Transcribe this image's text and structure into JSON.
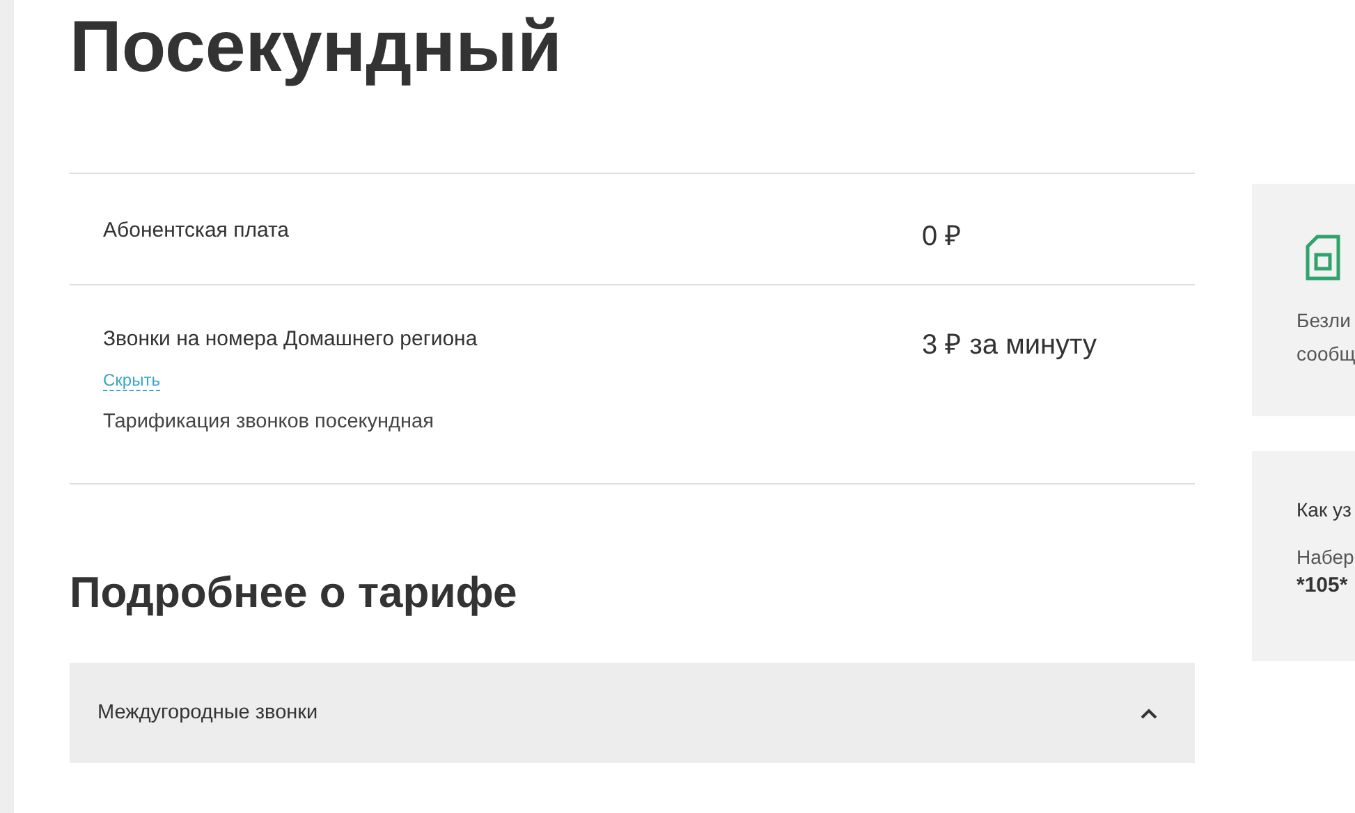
{
  "title": "Посекундный",
  "tariff_rows": [
    {
      "label": "Абонентская плата",
      "price": "0 ₽"
    },
    {
      "label": "Звонки на номера Домашнего региона",
      "price": "3 ₽ за минуту",
      "toggle": "Скрыть",
      "details": "Тарификация звонков посекундная"
    }
  ],
  "details_heading": "Подробнее о тарифе",
  "accordion": [
    {
      "label": "Междугородные звонки",
      "expanded": true
    }
  ],
  "side_cards": [
    {
      "kind": "icon",
      "lines": [
        "Безли",
        "сообщ"
      ]
    },
    {
      "kind": "info",
      "heading": "Как уз",
      "text": "Набер",
      "code": "*105*"
    }
  ]
}
